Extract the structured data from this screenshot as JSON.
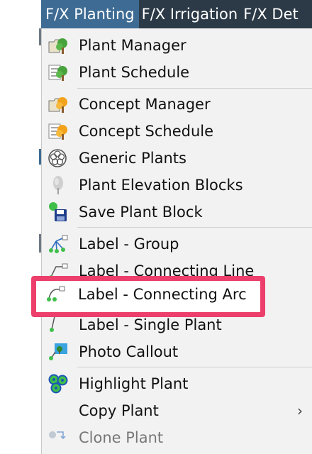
{
  "menubar": {
    "tabs": [
      {
        "label": "F/X Planting",
        "active": true
      },
      {
        "label": "F/X Irrigation",
        "active": false
      },
      {
        "label": "F/X Det",
        "active": false
      }
    ]
  },
  "menu": {
    "items": [
      {
        "label": "Plant Manager",
        "icon": "plant-manager-icon"
      },
      {
        "label": "Plant Schedule",
        "icon": "plant-schedule-icon"
      },
      {
        "label": "Concept Manager",
        "icon": "concept-manager-icon"
      },
      {
        "label": "Concept Schedule",
        "icon": "concept-schedule-icon"
      },
      {
        "label": "Generic Plants",
        "icon": "generic-plants-icon"
      },
      {
        "label": "Plant Elevation Blocks",
        "icon": "plant-elevation-icon"
      },
      {
        "label": "Save Plant Block",
        "icon": "save-plant-block-icon"
      },
      {
        "label": "Label - Group",
        "icon": "label-group-icon"
      },
      {
        "label": "Label - Connecting Line",
        "icon": "label-connecting-line-icon"
      },
      {
        "label": "Label - Connecting Arc",
        "icon": "label-connecting-arc-icon",
        "highlighted": true
      },
      {
        "label": "Label - Single Plant",
        "icon": "label-single-plant-icon"
      },
      {
        "label": "Photo Callout",
        "icon": "photo-callout-icon"
      },
      {
        "label": "Highlight Plant",
        "icon": "highlight-plant-icon"
      },
      {
        "label": "Copy Plant",
        "has_submenu": true,
        "submenu_arrow": "›"
      },
      {
        "label": "Clone Plant",
        "icon": "clone-plant-icon"
      }
    ]
  },
  "colors": {
    "menubar_bg": "#2c3a47",
    "active_tab_bg": "#3d6b93",
    "menu_bg": "#f2f2f2",
    "highlight_border": "#ec3f6c"
  }
}
